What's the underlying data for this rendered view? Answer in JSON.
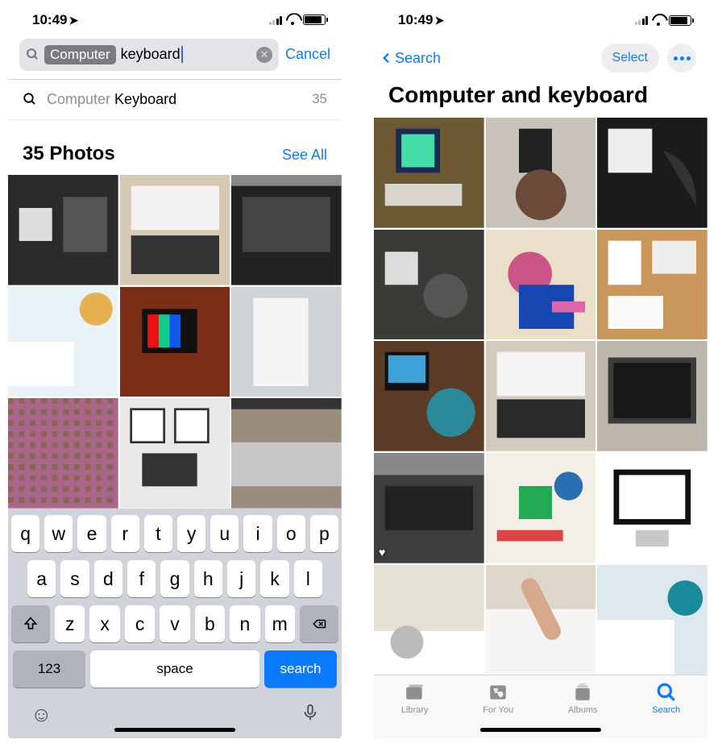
{
  "status": {
    "time": "10:49",
    "location_glyph": "➤"
  },
  "left": {
    "search": {
      "token": "Computer",
      "typed": "keyboard",
      "cancel": "Cancel"
    },
    "suggestion": {
      "prefix": "Computer",
      "match": "Keyboard",
      "count": "35"
    },
    "section": {
      "title": "35 Photos",
      "see_all": "See All"
    },
    "keyboard": {
      "row1": [
        "q",
        "w",
        "e",
        "r",
        "t",
        "y",
        "u",
        "i",
        "o",
        "p"
      ],
      "row2": [
        "a",
        "s",
        "d",
        "f",
        "g",
        "h",
        "j",
        "k",
        "l"
      ],
      "row3": [
        "z",
        "x",
        "c",
        "v",
        "b",
        "n",
        "m"
      ],
      "num": "123",
      "space": "space",
      "search": "search"
    }
  },
  "right": {
    "back": "Search",
    "select": "Select",
    "title": "Computer and  keyboard",
    "tabs": {
      "library": "Library",
      "foryou": "For You",
      "albums": "Albums",
      "search": "Search"
    }
  }
}
